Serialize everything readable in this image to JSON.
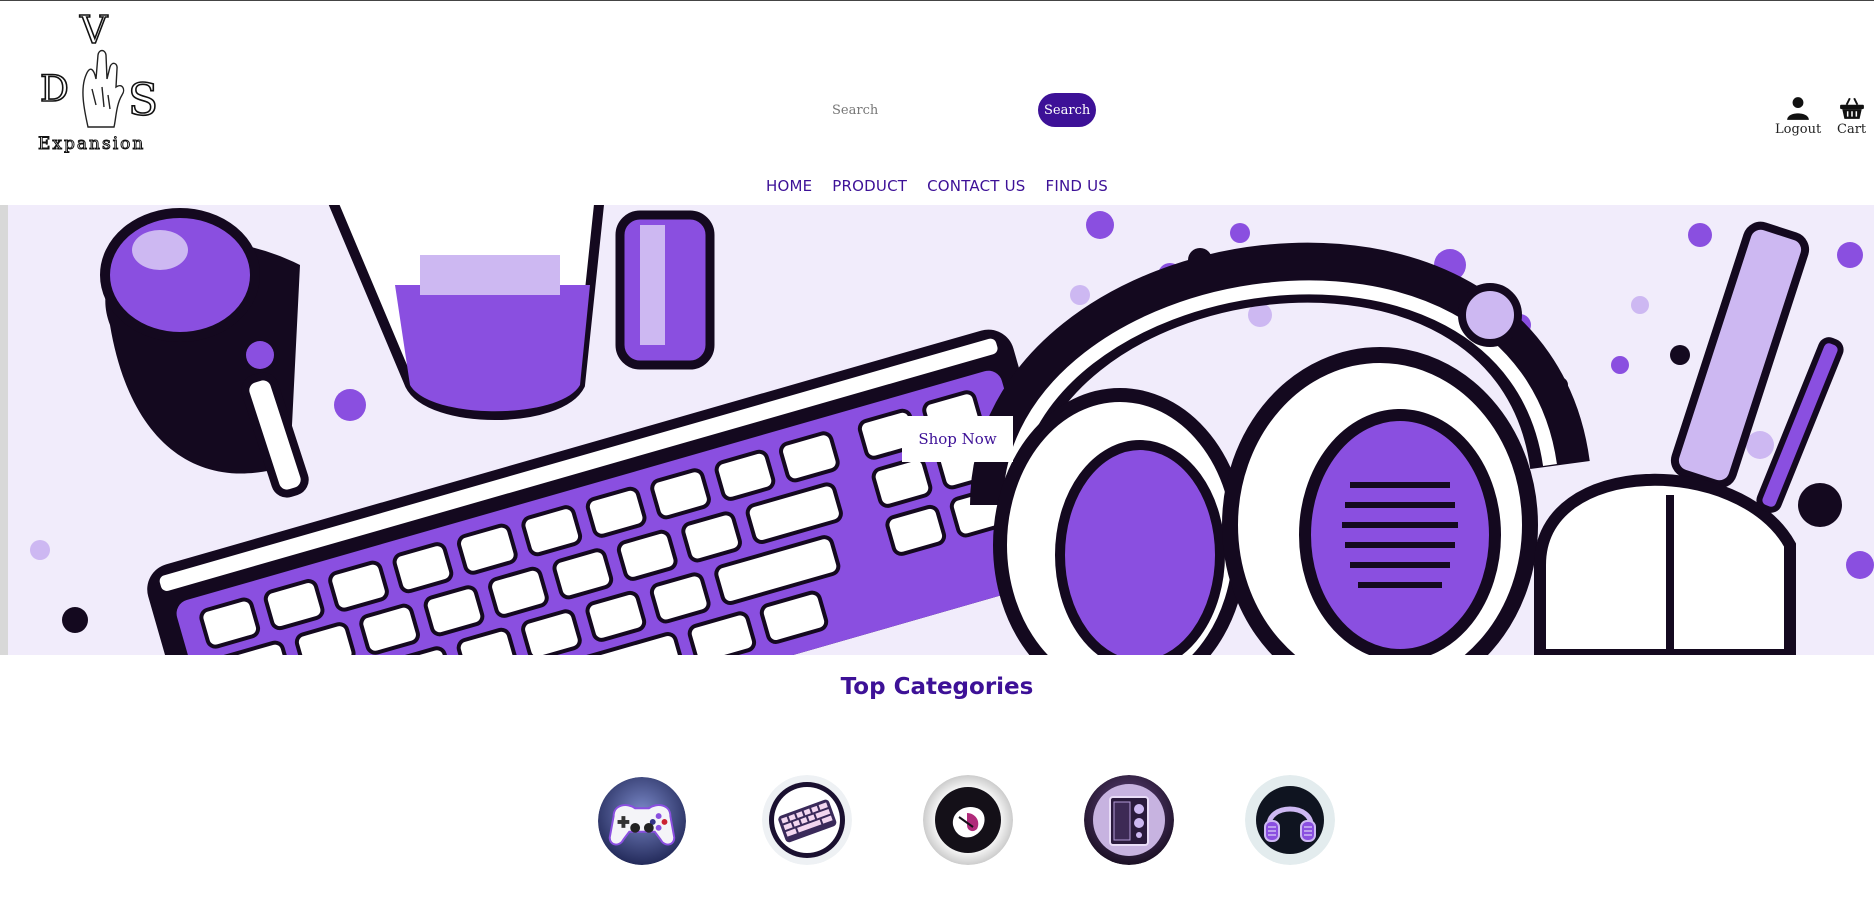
{
  "logo": {
    "letter_v": "V",
    "letter_d": "D",
    "letter_s": "S",
    "subtitle": "Expansion"
  },
  "search": {
    "placeholder": "Search",
    "button_label": "Search"
  },
  "account": {
    "logout_label": "Logout",
    "cart_label": "Cart",
    "logout_icon": "user-icon",
    "cart_icon": "basket-icon"
  },
  "nav": {
    "items": [
      "HOME",
      "PRODUCT",
      "CONTACT US",
      "FIND US"
    ]
  },
  "hero": {
    "button_label": "Shop Now"
  },
  "categories": {
    "title": "Top Categories",
    "items": [
      {
        "icon": "gamepad-icon"
      },
      {
        "icon": "keyboard-icon"
      },
      {
        "icon": "mouse-icon"
      },
      {
        "icon": "pc-case-icon"
      },
      {
        "icon": "headset-icon"
      }
    ]
  },
  "colors": {
    "accent": "#3d1197",
    "purple": "#8a4fe0",
    "lavender": "#cdb8f2",
    "dark": "#14091f"
  }
}
